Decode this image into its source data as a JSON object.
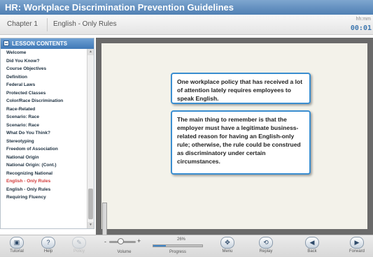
{
  "window": {
    "title": "HR: Workplace Discrimination Prevention Guidelines"
  },
  "chapter": {
    "label": "Chapter 1",
    "title": "English - Only Rules"
  },
  "timer": {
    "label": "hh:mm",
    "value": "00:01"
  },
  "sidebar": {
    "header": "LESSON CONTENTS",
    "items": [
      "Welcome",
      "Did You Know?",
      "Course Objectives",
      "Definition",
      "Federal Laws",
      "Protected Classes",
      "Color/Race Discrimination",
      "Race-Related",
      "Scenario: Race",
      "Scenario: Race",
      "What Do You Think?",
      "Stereotyping",
      "Freedom of Association",
      "National Origin",
      "National Origin: (Cont.)",
      "Recognizing National",
      "English - Only Rules",
      "English - Only Rules",
      "Requiring Fluency"
    ],
    "active_index": 16
  },
  "slide": {
    "callout_1": "One workplace policy that has received a lot of attention lately requires employees to speak English.",
    "callout_2": "The main thing to remember is that the employer must have a legitimate business-related reason for having an English-only rule; otherwise, the rule could be construed as discriminatory under certain circumstances."
  },
  "controls": {
    "tutorial": "Tutorial",
    "help": "Help",
    "policy": "Policy",
    "volume_label": "Volume",
    "volume_minus": "-",
    "volume_plus": "+",
    "progress_percent": "26%",
    "progress_value": 0.26,
    "progress_label": "Progress",
    "menu": "Menu",
    "replay": "Replay",
    "back": "Back",
    "forward": "Forward"
  },
  "colors": {
    "accent": "#3f78b6",
    "active_item": "#d23b3b",
    "progress_fill": "#3f86c8"
  }
}
